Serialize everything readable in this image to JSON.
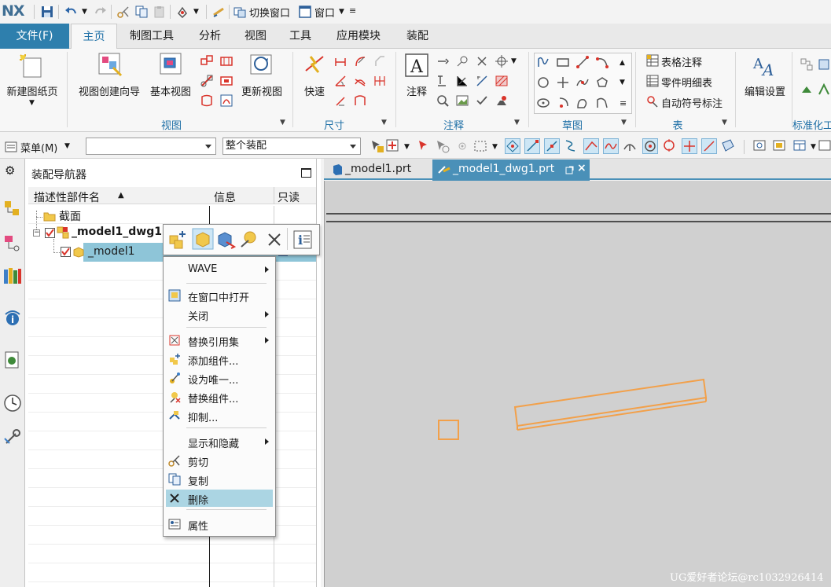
{
  "app": {
    "logo": "NX"
  },
  "quick_access": {
    "switch_window": "切换窗口",
    "window": "窗口"
  },
  "ribbon_tabs": {
    "file": "文件(F)",
    "home": "主页",
    "drafting_tools": "制图工具",
    "analysis": "分析",
    "view": "视图",
    "tools": "工具",
    "application": "应用模块",
    "assembly": "装配"
  },
  "ribbon": {
    "new_sheet": "新建图纸页",
    "view_wizard": "视图创建向导",
    "base_view": "基本视图",
    "update_view": "更新视图",
    "quick": "快速",
    "note": "注释",
    "edit_settings": "编辑设置",
    "table_note": "表格注释",
    "parts_list": "零件明细表",
    "auto_balloon": "自动符号标注",
    "groups": {
      "view": "视图",
      "dimension": "尺寸",
      "annotation": "注释",
      "sketch": "草图",
      "table": "表",
      "standardization": "标准化工"
    }
  },
  "toolbar2": {
    "menu": "菜单(M)",
    "filter_value": "",
    "scope_value": "整个装配"
  },
  "navigator": {
    "title": "装配导航器",
    "columns": {
      "name": "描述性部件名",
      "info": "信息",
      "readonly": "只读"
    },
    "rows": [
      {
        "label": "截面"
      },
      {
        "label": "_model1_dwg1"
      },
      {
        "label": "_model1"
      }
    ]
  },
  "doc_tabs": [
    {
      "label": "_model1.prt"
    },
    {
      "label": "_model1_dwg1.prt"
    }
  ],
  "context_menu": {
    "items": [
      {
        "label": "WAVE",
        "submenu": true
      },
      {
        "label": "在窗口中打开"
      },
      {
        "label": "关闭",
        "submenu": true
      },
      {
        "label": "替换引用集",
        "submenu": true
      },
      {
        "label": "添加组件..."
      },
      {
        "label": "设为唯一..."
      },
      {
        "label": "替换组件..."
      },
      {
        "label": "抑制..."
      },
      {
        "label": "显示和隐藏",
        "submenu": true
      },
      {
        "label": "剪切"
      },
      {
        "label": "复制"
      },
      {
        "label": "删除",
        "highlighted": true
      },
      {
        "label": "属性"
      }
    ]
  },
  "watermark": "UG爱好者论坛@rc1032926414",
  "colors": {
    "accent": "#2e7fad",
    "menu_highlight": "#abd5e3",
    "part_edge": "#f2a04a"
  }
}
